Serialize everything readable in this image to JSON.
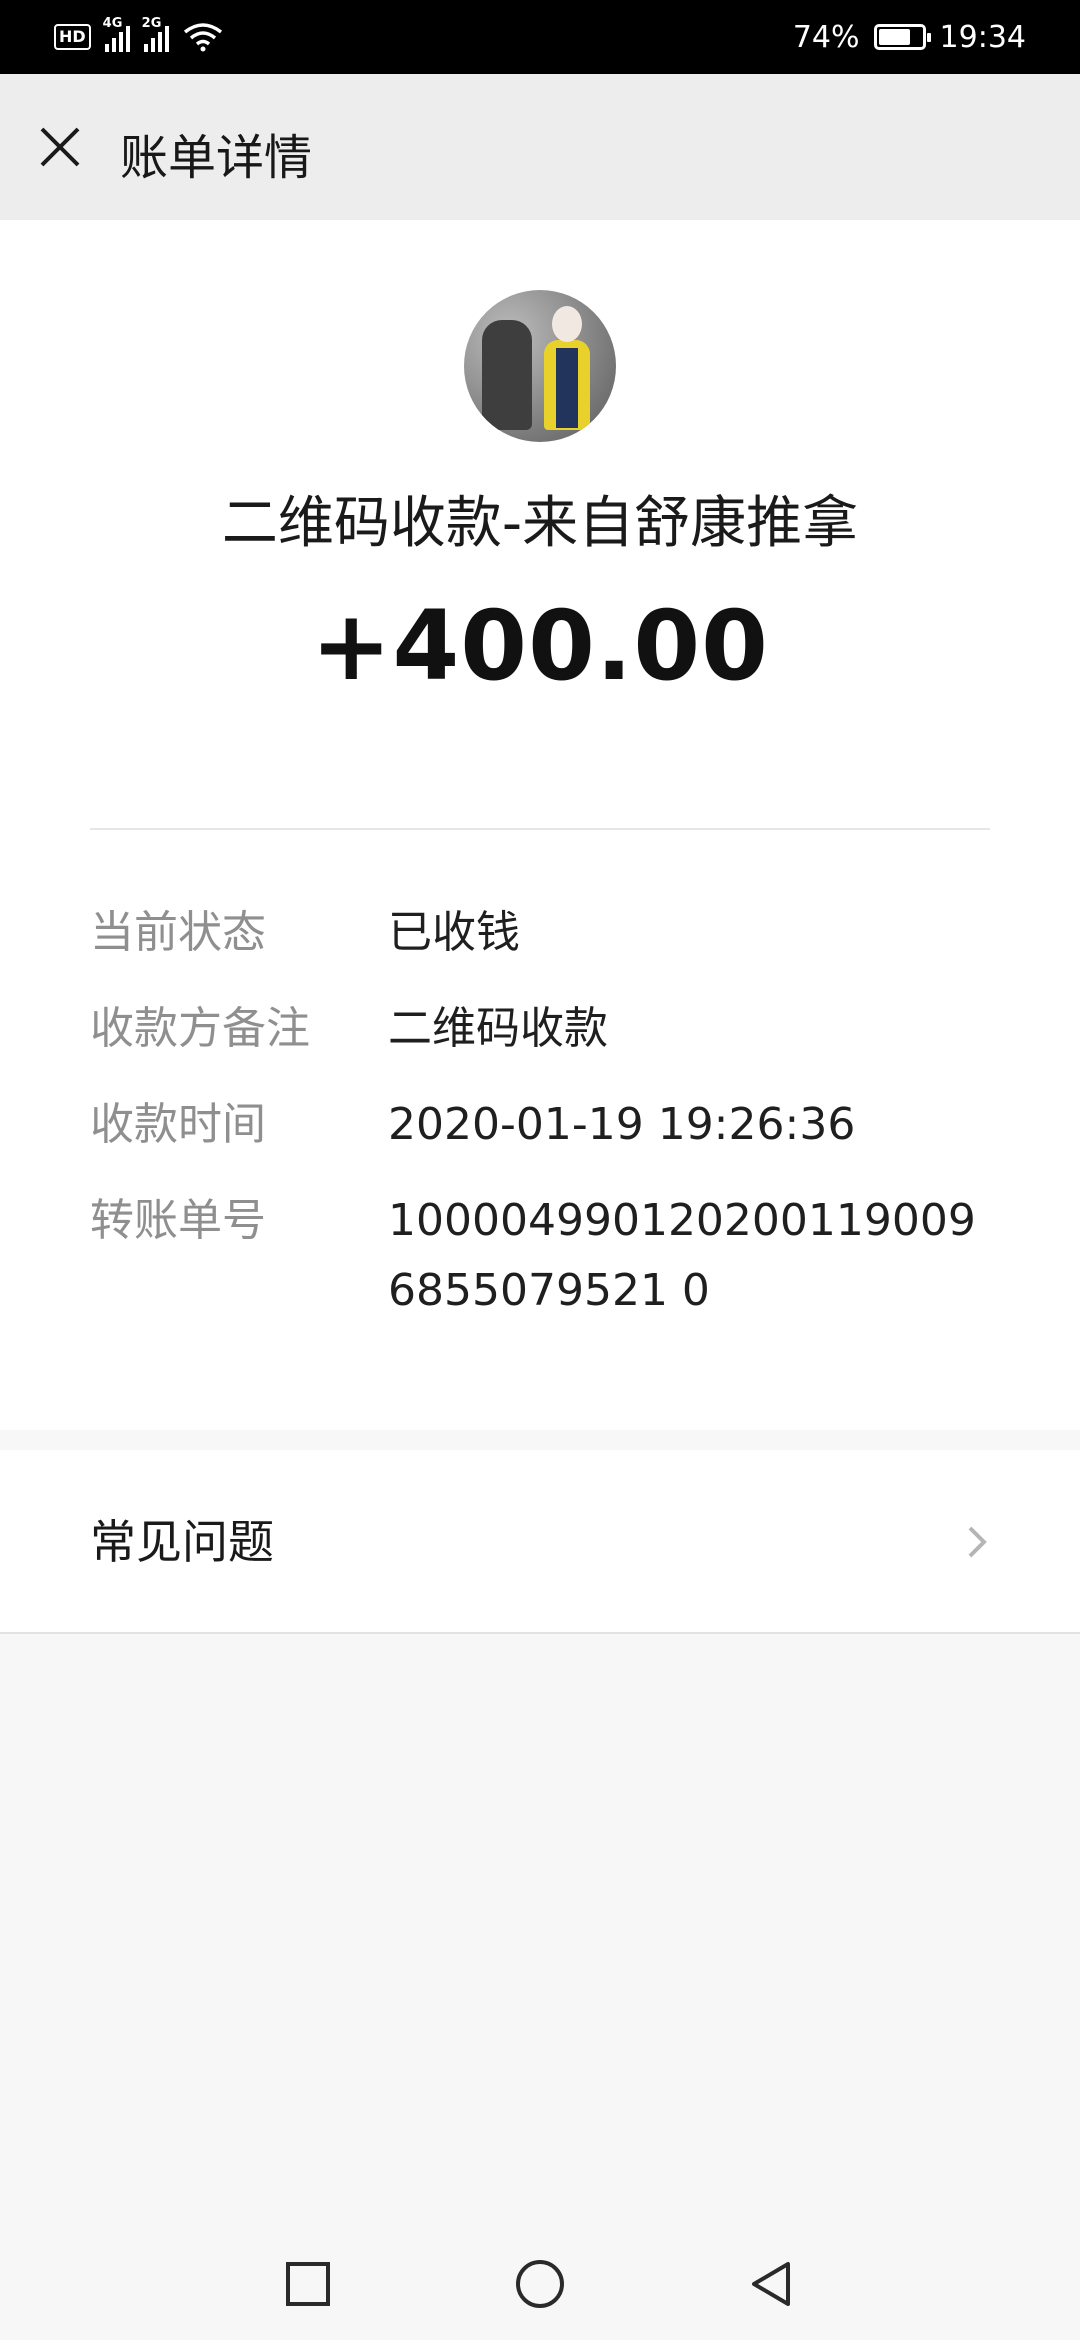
{
  "status_bar": {
    "hd_label": "HD",
    "network_1": "4G",
    "network_2": "2G",
    "battery_percent": "74%",
    "battery_level": 0.74,
    "time": "19:34"
  },
  "header": {
    "title": "账单详情",
    "close_icon": "close-icon"
  },
  "transaction": {
    "avatar_icon": "avatar",
    "title": "二维码收款-来自舒康推拿",
    "amount": "+400.00",
    "details": [
      {
        "label": "当前状态",
        "value": "已收钱"
      },
      {
        "label": "收款方备注",
        "value": "二维码收款"
      },
      {
        "label": "收款时间",
        "value": "2020-01-19 19:26:36"
      },
      {
        "label": "转账单号",
        "value": "1000049901202001190096855079521 0"
      }
    ]
  },
  "faq": {
    "label": "常见问题",
    "icon": "chevron-right-icon"
  },
  "navigation": {
    "items": [
      "square-recents-icon",
      "circle-home-icon",
      "triangle-back-icon"
    ]
  },
  "colors": {
    "status_bar_bg": "#000000",
    "header_bg": "#ededed",
    "page_bg": "#f7f7f7",
    "label_gray": "#8f8f8f"
  }
}
